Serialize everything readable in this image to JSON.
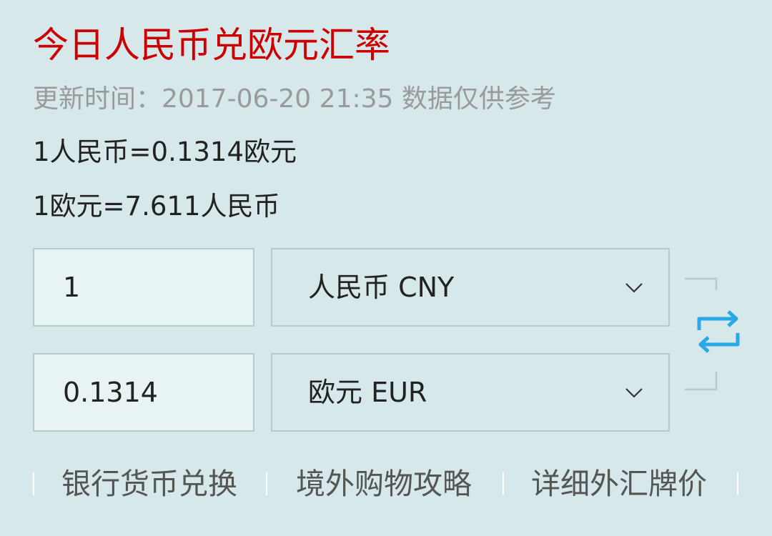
{
  "title": "今日人民币兑欧元汇率",
  "update_line": "更新时间：2017-06-20 21:35 数据仅供参考",
  "rates": {
    "cny_to_eur": "1人民币=0.1314欧元",
    "eur_to_cny": "1欧元=7.611人民币"
  },
  "converter": {
    "from_amount": "1",
    "from_currency": "人民币 CNY",
    "to_amount": "0.1314",
    "to_currency": "欧元 EUR"
  },
  "links": [
    "银行货币兑换",
    "境外购物攻略",
    "详细外汇牌价"
  ],
  "colors": {
    "background": "#d6e8ea",
    "title": "#cc0000",
    "swap_icon": "#29a8e8"
  },
  "icons": {
    "dropdown": "chevron-down-icon",
    "swap": "swap-arrows-icon"
  }
}
